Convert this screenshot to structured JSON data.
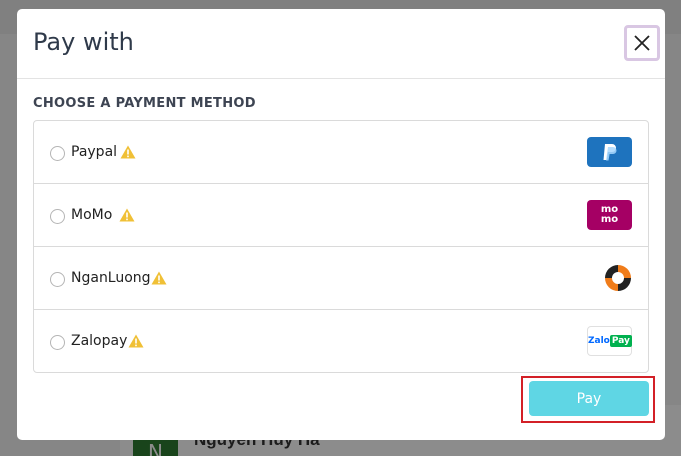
{
  "background": {
    "avatar_letter": "N",
    "user_name": "Nguyen Huy Ha"
  },
  "modal": {
    "title": "Pay with",
    "section_label": "CHOOSE A PAYMENT METHOD",
    "methods": [
      {
        "name": "Paypal",
        "warning": true,
        "logo": "paypal-logo"
      },
      {
        "name": "MoMo",
        "warning": true,
        "logo": "momo-logo",
        "logo_text": "mo mo"
      },
      {
        "name": "NganLuong",
        "warning": true,
        "logo": "nganluong-logo"
      },
      {
        "name": "Zalopay",
        "warning": true,
        "logo": "zalopay-logo",
        "logo_text_a": "Zalo",
        "logo_text_b": "Pay"
      }
    ],
    "pay_label": "Pay"
  },
  "colors": {
    "pay_button": "#5fd6e4",
    "highlight_border": "#d32027",
    "warning_icon": "#f0c036",
    "paypal_brand": "#1e73be",
    "momo_brand": "#a50064",
    "zalopay_brand": "#0068ff"
  }
}
